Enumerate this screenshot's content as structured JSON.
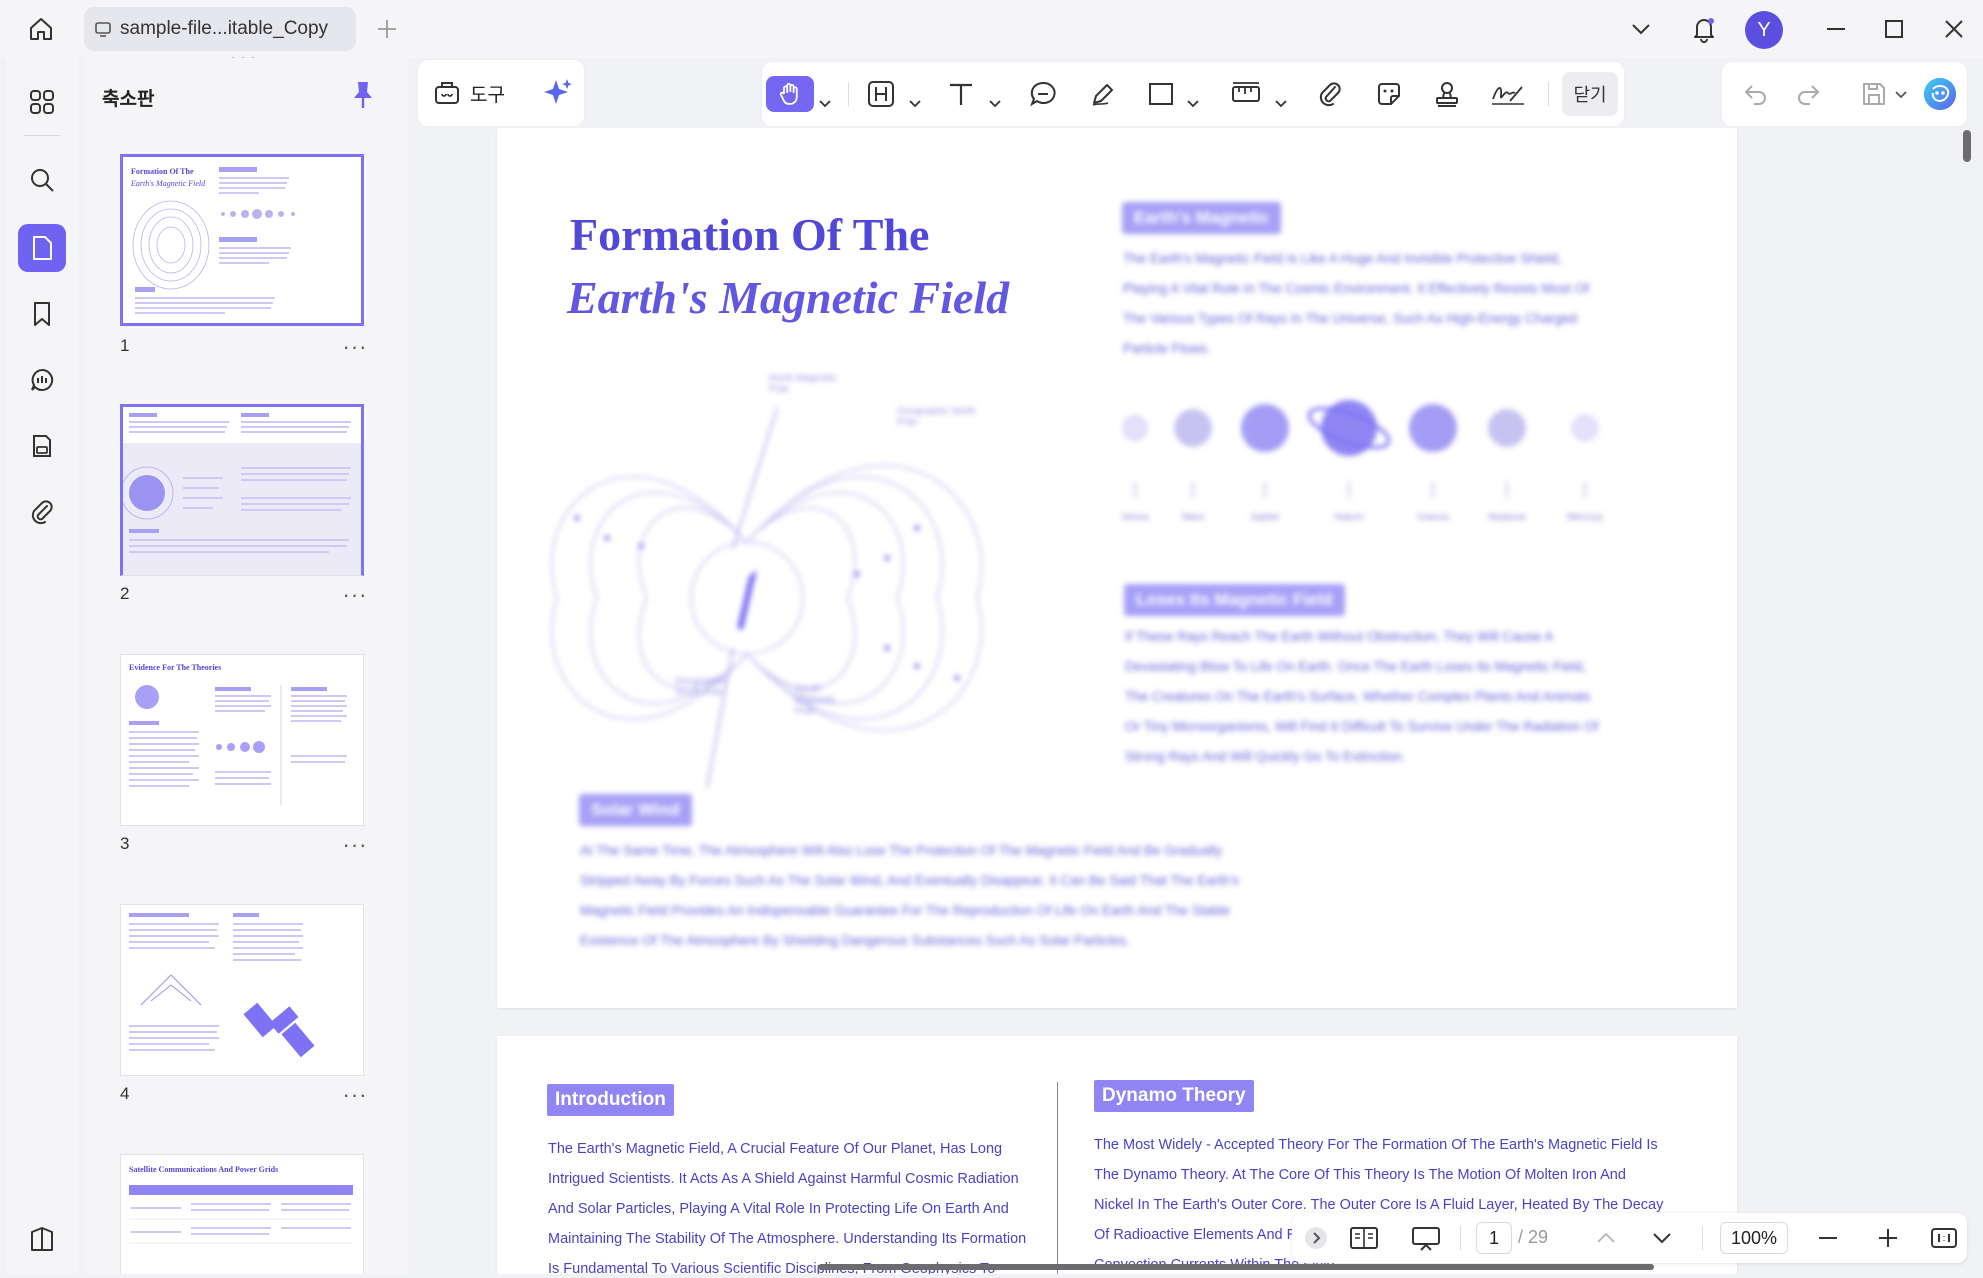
{
  "titlebar": {
    "tab_title": "sample-file...itable_Copy",
    "avatar_letter": "Y"
  },
  "sidebar": {
    "panel_title": "축소판",
    "thumbnails": [
      {
        "page": "1",
        "caption": "Formation Of The",
        "caption2": "Earth's Magnetic Field"
      },
      {
        "page": "2",
        "caption": "",
        "caption2": ""
      },
      {
        "page": "3",
        "caption": "Evidence For The Theories",
        "caption2": ""
      },
      {
        "page": "4",
        "caption": "",
        "caption2": ""
      },
      {
        "page": "",
        "caption": "Satellite Communications And Power Grids",
        "caption2": ""
      }
    ],
    "more_glyph": "···"
  },
  "toolbar": {
    "tools_label": "도구",
    "close_label": "닫기"
  },
  "page1": {
    "title_line1": "Formation Of The",
    "title_line2": "Earth's Magnetic Field",
    "tag_magnetic": "Earth's Magnetic",
    "para_magnetic": "The Earth's Magnetic Field Is Like A Huge And Invisible Protective Shield, Playing A Vital Role In The Cosmic Environment. It Effectively Resists Most Of The Various Types Of Rays In The Universe, Such As High-Energy Charged Particle Flows.",
    "tag_loses": "Loses Its Magnetic Field",
    "para_loses": "If These Rays Reach The Earth Without Obstruction, They Will Cause A Devastating Blow To Life On Earth. Once The Earth Loses Its Magnetic Field, The Creatures On The Earth's Surface, Whether Complex Plants And Animals Or Tiny Microorganisms, Will Find It Difficult To Survive Under The Radiation Of Strong Rays And Will Quickly Go To Extinction.",
    "tag_solar": "Solar Wind",
    "para_solar": "At The Same Time, The Atmosphere Will Also Lose The Protection Of The Magnetic Field And Be Gradually Stripped Away By Forces Such As The Solar Wind, And Eventually Disappear. It Can Be Said That The Earth's Magnetic Field Provides An Indispensable Guarantee For The Reproduction Of Life On Earth And The Stable Existence Of The Atmosphere By Shielding Dangerous Substances Such As Solar Particles.",
    "diagram_labels": {
      "north_magnetic": "North Magnetic Pole",
      "geo_north": "Geographic North Pole",
      "geo_south": "Geographic South Pole",
      "south_magnetic": "South Magnetic Pole"
    },
    "planets": [
      "Venus",
      "Mars",
      "Jupiter",
      "Saturn",
      "Uranus",
      "Neptune",
      "Mercury"
    ]
  },
  "page2": {
    "tag_intro": "Introduction",
    "para_intro": "The Earth's Magnetic Field, A Crucial Feature Of Our Planet, Has Long Intrigued Scientists. It Acts As A Shield Against Harmful Cosmic Radiation And Solar Particles, Playing A Vital Role In Protecting Life On Earth And Maintaining The Stability Of The Atmosphere. Understanding Its Formation Is Fundamental To Various Scientific Disciplines, From Geophysics To",
    "tag_dynamo": "Dynamo Theory",
    "para_dynamo": "The Most Widely - Accepted Theory For The Formation Of The Earth's Magnetic Field Is The Dynamo Theory. At The Core Of This Theory Is The Motion Of Molten Iron And Nickel In The Earth's Outer Core. The Outer Core Is A Fluid Layer, Heated By The Decay Of Radioactive Elements And Residual Heat From The Earth's Formation, Driving Convection Currents Within The Fluid."
  },
  "nav": {
    "current_page": "1",
    "total_pages": "/ 29",
    "zoom": "100%"
  },
  "colors": {
    "accent": "#6f63f2",
    "doc_purple": "#5148d8",
    "tag_purple": "#a7a0f7"
  }
}
